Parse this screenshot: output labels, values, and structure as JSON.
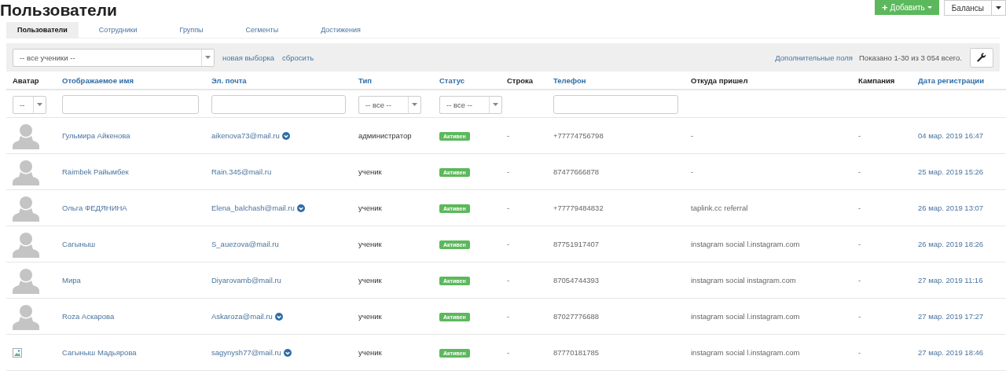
{
  "page_title": "Пользователи",
  "header_buttons": {
    "add": {
      "label": "Добавить",
      "icon": "+"
    },
    "balances": {
      "label": "Балансы"
    }
  },
  "tabs": [
    {
      "label": "Пользователи",
      "selected": true
    },
    {
      "label": "Сотрудники",
      "selected": false
    },
    {
      "label": "Группы",
      "selected": false
    },
    {
      "label": "Сегменты",
      "selected": false
    },
    {
      "label": "Достижения",
      "selected": false
    }
  ],
  "toolbar": {
    "selection": "-- все ученики --",
    "links": [
      "новая выборка",
      "сбросить"
    ],
    "extra_fields": "Дополнительные поля",
    "summary": "Показано 1-30 из 3 054 всего."
  },
  "table": {
    "columns": [
      {
        "label": "Аватар",
        "sortable": false,
        "filter": {
          "kind": "select",
          "value": "--"
        }
      },
      {
        "label": "Отображаемое имя",
        "sortable": true,
        "filter": {
          "kind": "input"
        }
      },
      {
        "label": "Эл. почта",
        "sortable": true,
        "filter": {
          "kind": "input"
        }
      },
      {
        "label": "Тип",
        "sortable": true,
        "filter": {
          "kind": "select",
          "value": "-- все --"
        }
      },
      {
        "label": "Статус",
        "sortable": true,
        "filter": {
          "kind": "select",
          "value": "-- все --"
        }
      },
      {
        "label": "Строка",
        "sortable": false,
        "filter": {
          "kind": "none"
        }
      },
      {
        "label": "Телефон",
        "sortable": true,
        "filter": {
          "kind": "input"
        }
      },
      {
        "label": "Откуда пришел",
        "sortable": false,
        "filter": {
          "kind": "none"
        }
      },
      {
        "label": "Кампания",
        "sortable": false,
        "filter": {
          "kind": "none"
        }
      },
      {
        "label": "Дата регистрации",
        "sortable": true,
        "filter": {
          "kind": "none"
        }
      }
    ],
    "rows": [
      {
        "kind": "silhouette",
        "name": "Гульмира Айкенова",
        "email": "aikenova73@mail.ru",
        "verified": true,
        "type": "администратор",
        "status": "Активен",
        "line": "-",
        "phone": "+77774756798",
        "source": "-",
        "campaign": "-",
        "registered": "04 мар. 2019 16:47"
      },
      {
        "kind": "silhouette",
        "name": "Raimbek Райымбек",
        "email": "Rain.345@mail.ru",
        "verified": false,
        "type": "ученик",
        "status": "Активен",
        "line": "-",
        "phone": "87477666878",
        "source": "-",
        "campaign": "-",
        "registered": "25 мар. 2019 15:26"
      },
      {
        "kind": "silhouette",
        "name": "Ольга ФЕДЯНИНА",
        "email": "Elena_balchash@mail.ru",
        "verified": true,
        "type": "ученик",
        "status": "Активен",
        "line": "-",
        "phone": "+77779484832",
        "source": "taplink.cc referral",
        "campaign": "-",
        "registered": "26 мар. 2019 13:07"
      },
      {
        "kind": "silhouette",
        "name": "Сагыныш",
        "email": "S_auezova@mail.ru",
        "verified": false,
        "type": "ученик",
        "status": "Активен",
        "line": "-",
        "phone": "87751917407",
        "source": "instagram social l.instagram.com",
        "campaign": "-",
        "registered": "26 мар. 2019 18:26"
      },
      {
        "kind": "silhouette",
        "name": "Мира",
        "email": "Diyarovamb@mail.ru",
        "verified": false,
        "type": "ученик",
        "status": "Активен",
        "line": "-",
        "phone": "87054744393",
        "source": "instagram social instagram.com",
        "campaign": "-",
        "registered": "27 мар. 2019 11:16"
      },
      {
        "kind": "silhouette",
        "name": "Roza Аскарова",
        "email": "Askaroza@mail.ru",
        "verified": true,
        "type": "ученик",
        "status": "Активен",
        "line": "-",
        "phone": "87027776688",
        "source": "instagram social l.instagram.com",
        "campaign": "-",
        "registered": "27 мар. 2019 17:27"
      },
      {
        "kind": "broken",
        "name": "Сагыныш Мадьярова",
        "email": "sagynysh77@mail.ru",
        "verified": true,
        "type": "ученик",
        "status": "Активен",
        "line": "-",
        "phone": "87770181785",
        "source": "instagram social l.instagram.com",
        "campaign": "-",
        "registered": "27 мар. 2019 18:46"
      }
    ]
  }
}
